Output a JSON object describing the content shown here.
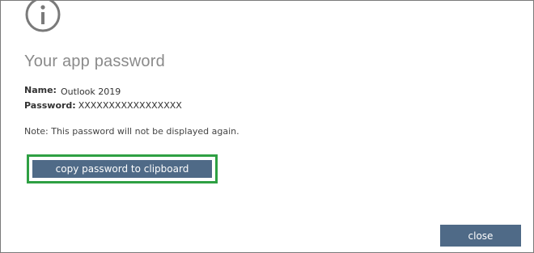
{
  "dialog": {
    "icon": "info-icon",
    "title": "Your app password",
    "name_label": "Name:",
    "name_value": "Outlook 2019",
    "password_label": "Password:",
    "password_value": "XXXXXXXXXXXXXXXXX",
    "note": "Note: This password will not be displayed again.",
    "copy_button_label": "copy password to clipboard",
    "close_button_label": "close"
  },
  "colors": {
    "button_bg": "#4f6a87",
    "highlight_border": "#2ea043",
    "title_text": "#8a8a8a",
    "icon_stroke": "#7a7a7a"
  }
}
